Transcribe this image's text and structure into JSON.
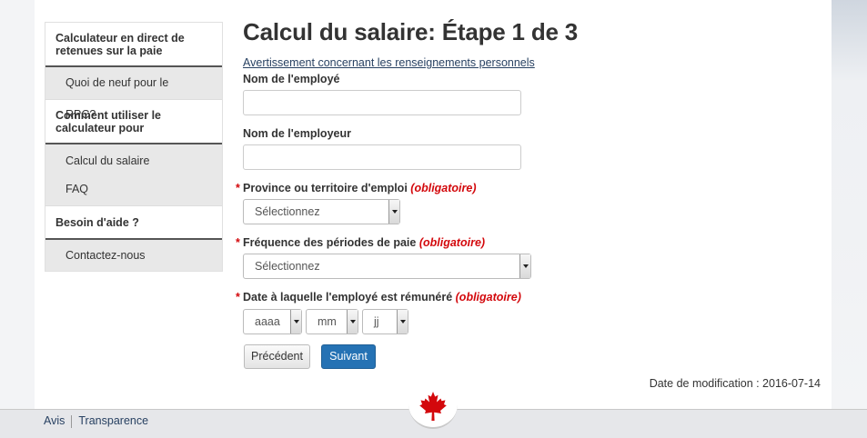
{
  "sidebar": {
    "sections": [
      {
        "heading": "Calculateur en direct de retenues sur la paie",
        "items": [
          "Quoi de neuf pour le RPC?"
        ]
      },
      {
        "heading": "Comment utiliser le calculateur pour",
        "items": [
          "Calcul du salaire",
          "FAQ"
        ]
      },
      {
        "heading": "Besoin d'aide ?",
        "items": [
          "Contactez-nous"
        ]
      }
    ]
  },
  "main": {
    "title": "Calcul du salaire: Étape 1 de 3",
    "privacy_link": "Avertissement concernant les renseignements personnels",
    "fields": {
      "employee_name_label": "Nom de l'employé",
      "employer_name_label": "Nom de l'employeur",
      "province_label": "Province ou territoire d'emploi",
      "frequency_label": "Fréquence des périodes de paie",
      "date_label": "Date à laquelle l'employé est rémunéré",
      "required_text": "(obligatoire)",
      "required_star": "*",
      "province_value": "Sélectionnez",
      "frequency_value": "Sélectionnez",
      "date_year": "aaaa",
      "date_month": "mm",
      "date_day": "jj"
    },
    "buttons": {
      "previous": "Précédent",
      "next": "Suivant"
    },
    "modified": "Date de modification : 2016-07-14"
  },
  "footer": {
    "links": [
      "Avis",
      "Transparence"
    ]
  },
  "colors": {
    "accent": "#2572b4",
    "required": "#d3080c",
    "link": "#284162"
  }
}
